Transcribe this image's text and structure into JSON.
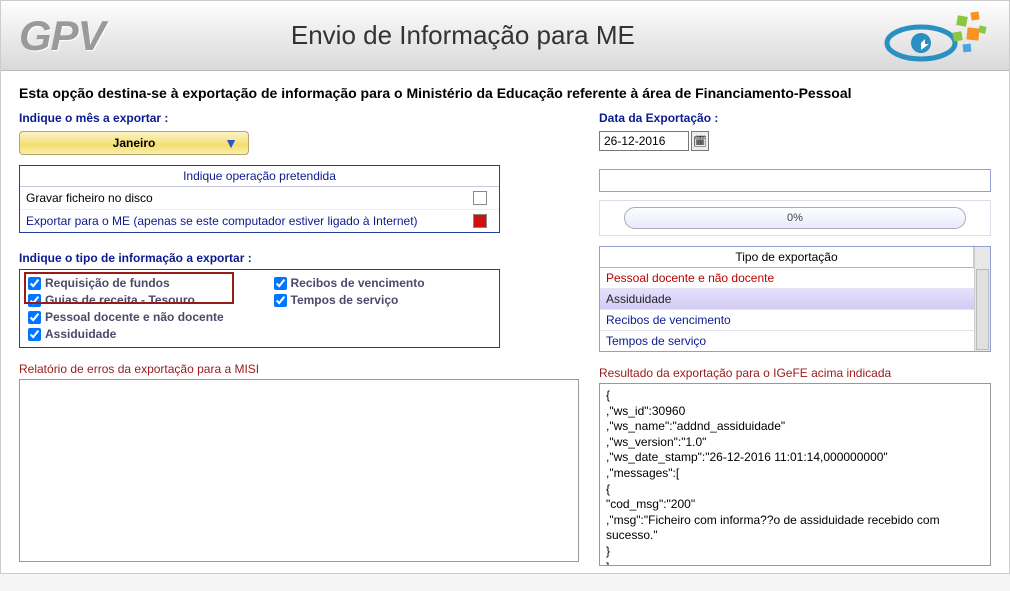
{
  "app": {
    "logo_text": "GPV",
    "window_title": "Envio de Informação para ME"
  },
  "intro": "Esta opção destina-se à exportação de informação para o Ministério da Educação referente à área de Financiamento-Pessoal",
  "left": {
    "month_label": "Indique o mês a exportar :",
    "month_value": "Janeiro",
    "op_box_title": "Indique operação pretendida",
    "op_row1": "Gravar ficheiro no disco",
    "op_row2": "Exportar para o ME (apenas se este computador estiver ligado à Internet)",
    "info_label": "Indique o tipo de informação a exportar :",
    "checks": {
      "c1": "Requisição de fundos",
      "c2": "Recibos de vencimento",
      "c3": "Guias de receita - Tesouro",
      "c4": "Tempos de serviço",
      "c5": "Pessoal docente e não docente",
      "c6": "Assiduidade"
    },
    "errors_label": "Relatório de erros da exportação para a MISI"
  },
  "right": {
    "date_label": "Data da Exportação :",
    "date_value": "26-12-2016",
    "progress_text": "0%",
    "export_type_header": "Tipo de exportação",
    "export_type_items": {
      "i1": "Pessoal docente e não docente",
      "i2": "Assiduidade",
      "i3": "Recibos de vencimento",
      "i4": "Tempos de serviço"
    },
    "result_label": "Resultado da exportação para o IGeFE acima indicada",
    "result_text": "{\n,\"ws_id\":30960\n,\"ws_name\":\"addnd_assiduidade\"\n,\"ws_version\":\"1.0\"\n,\"ws_date_stamp\":\"26-12-2016 11:01:14,000000000\"\n,\"messages\":[\n{\n\"cod_msg\":\"200\"\n,\"msg\":\"Ficheiro com informa??o de assiduidade recebido com sucesso.\"\n}\n]"
  }
}
